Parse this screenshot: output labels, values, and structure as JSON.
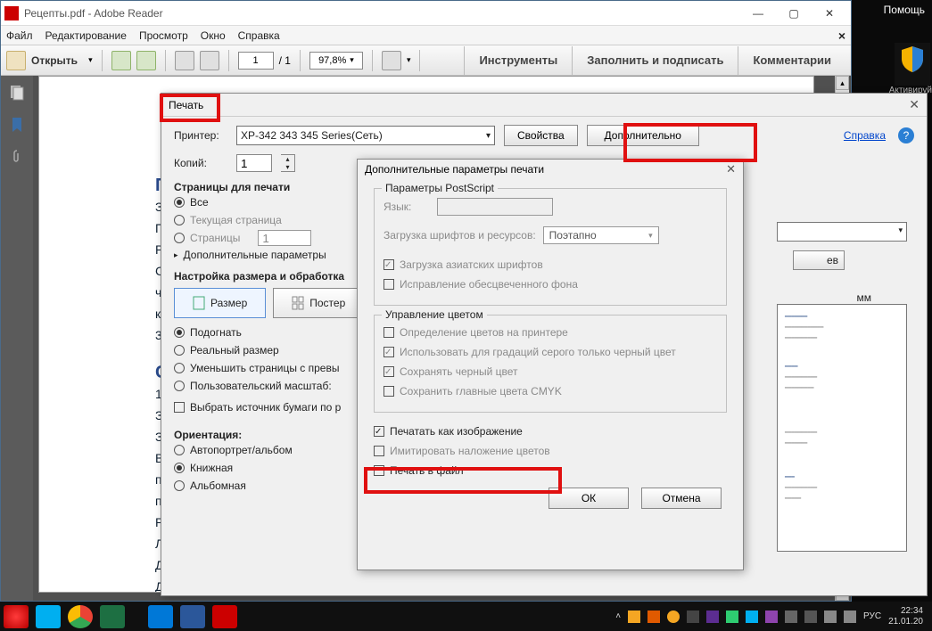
{
  "desktop": {
    "help": "Помощь",
    "activate": "Активируй"
  },
  "titlebar": {
    "text": "Рецепты.pdf - Adobe Reader"
  },
  "menubar": {
    "items": [
      "Файл",
      "Редактирование",
      "Просмотр",
      "Окно",
      "Справка"
    ]
  },
  "toolbar": {
    "open": "Открыть",
    "page_current": "1",
    "page_total": "/ 1",
    "zoom": "97,8%",
    "right": [
      "Инструменты",
      "Заполнить и подписать",
      "Комментарии"
    ]
  },
  "doc": {
    "heading1": "П",
    "lines": [
      "З",
      "П",
      "Р",
      "С",
      "ч",
      "к",
      "3"
    ],
    "heading2": "С",
    "lines2": [
      "1",
      "З",
      "З",
      "В",
      "п",
      "п",
      "Р",
      "Л",
      "Д",
      "Д"
    ]
  },
  "print": {
    "title": "Печать",
    "printer_label": "Принтер:",
    "printer_value": "XP-342 343 345 Series(Сеть)",
    "properties": "Свойства",
    "advanced": "Дополнительно",
    "help": "Справка",
    "copies_label": "Копий:",
    "copies_value": "1",
    "pages_group": "Страницы для печати",
    "opt_all": "Все",
    "opt_current": "Текущая страница",
    "opt_pages": "Страницы",
    "pages_value": "1",
    "more_params": "Дополнительные параметры",
    "size_group": "Настройка размера и обработка",
    "btn_size": "Размер",
    "btn_poster": "Постер",
    "fit_opts": [
      "Подогнать",
      "Реальный размер",
      "Уменьшить страницы с превы",
      "Пользовательский масштаб:"
    ],
    "paper_source": "Выбрать источник бумаги по р",
    "orientation_label": "Ориентация:",
    "orient_opts": [
      "Автопортрет/альбом",
      "Книжная",
      "Альбомная"
    ],
    "mm": "мм",
    "small_btn": "ев"
  },
  "adv": {
    "title": "Дополнительные параметры печати",
    "ps_group": "Параметры PostScript",
    "lang": "Язык:",
    "fonts_load": "Загрузка шрифтов и ресурсов:",
    "fonts_value": "Поэтапно",
    "asian": "Загрузка азиатских шрифтов",
    "discolor": "Исправление обесцвеченного фона",
    "color_group": "Управление цветом",
    "color_opts": [
      "Определение цветов на принтере",
      "Использовать для градаций серого только черный цвет",
      "Сохранять черный цвет",
      "Сохранить главные цвета CMYK"
    ],
    "print_image": "Печатать как изображение",
    "overprint": "Имитировать наложение цветов",
    "to_file": "Печать в файл",
    "ok": "ОК",
    "cancel": "Отмена"
  },
  "taskbar": {
    "lang": "РУС",
    "time": "22:34",
    "date": "21.01.20"
  }
}
